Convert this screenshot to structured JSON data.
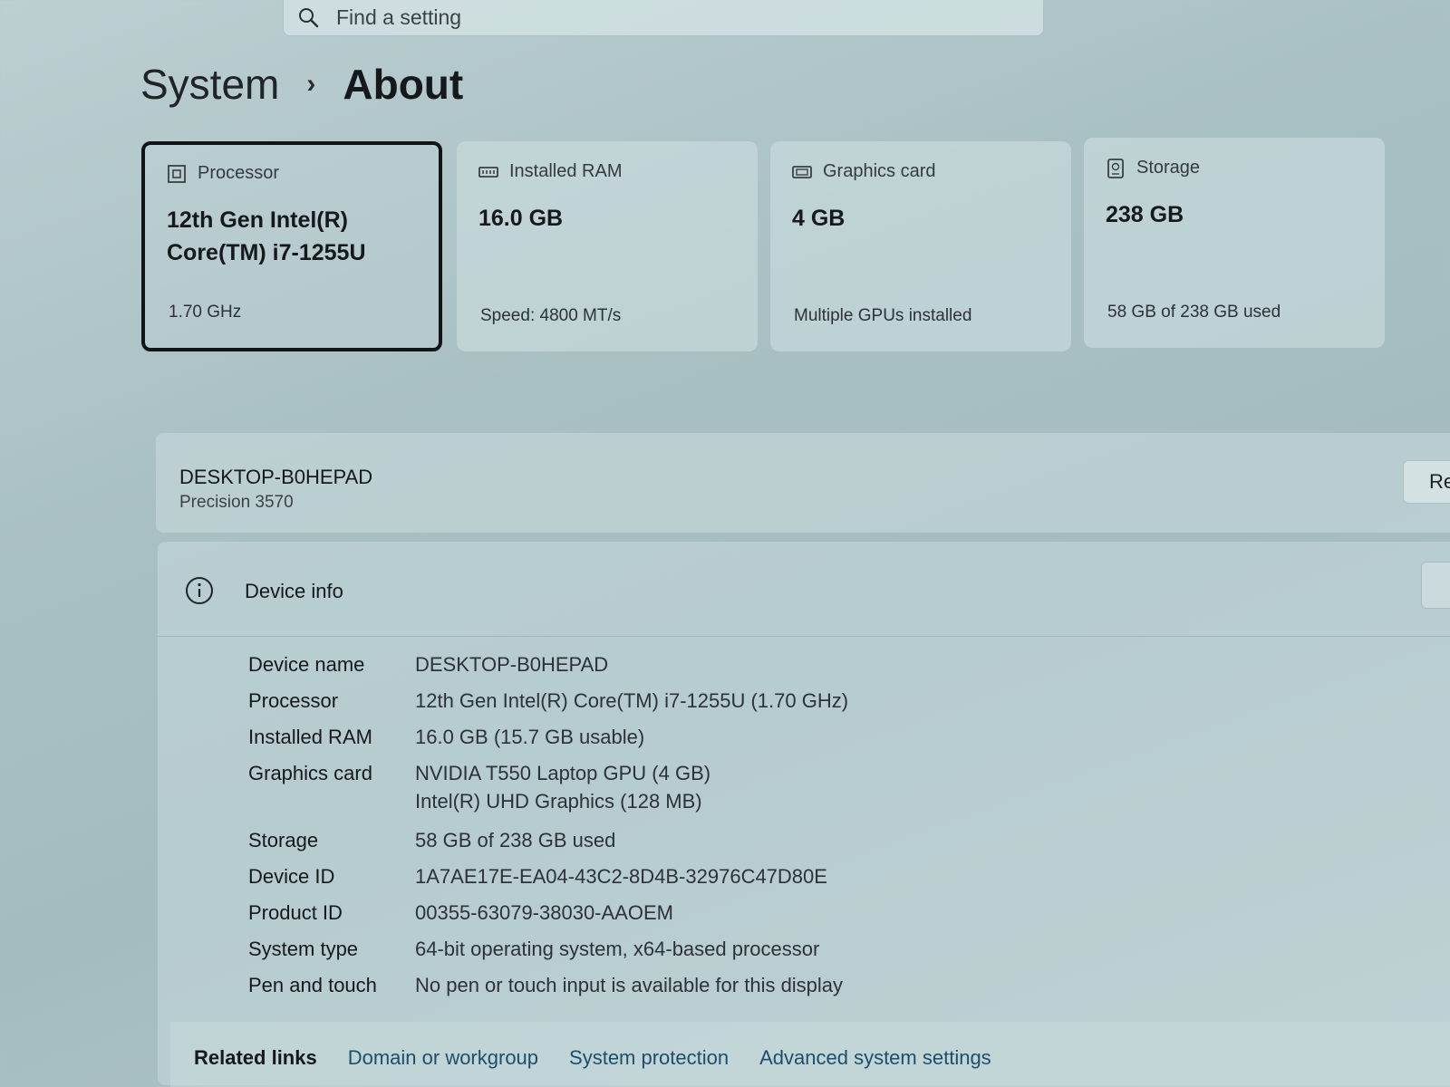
{
  "search": {
    "placeholder": "Find a setting"
  },
  "breadcrumb": {
    "parent": "System",
    "separator": "›",
    "current": "About"
  },
  "cards": [
    {
      "title": "Processor",
      "value_line1": "12th Gen Intel(R)",
      "value_line2": "Core(TM) i7-1255U",
      "sub": "1.70 GHz",
      "icon": "processor-icon"
    },
    {
      "title": "Installed RAM",
      "value_line1": "16.0 GB",
      "value_line2": "",
      "sub": "Speed: 4800 MT/s",
      "icon": "ram-icon"
    },
    {
      "title": "Graphics card",
      "value_line1": "4 GB",
      "value_line2": "",
      "sub": "Multiple GPUs installed",
      "icon": "graphics-card-icon"
    },
    {
      "title": "Storage",
      "value_line1": "238 GB",
      "value_line2": "",
      "sub": "58 GB of 238 GB used",
      "icon": "storage-icon"
    }
  ],
  "device": {
    "name": "DESKTOP-B0HEPAD",
    "model": "Precision 3570",
    "rename_label": "Re"
  },
  "device_info": {
    "title": "Device info",
    "rows": [
      {
        "key": "Device name",
        "value": "DESKTOP-B0HEPAD"
      },
      {
        "key": "Processor",
        "value": "12th Gen Intel(R) Core(TM) i7-1255U (1.70 GHz)"
      },
      {
        "key": "Installed RAM",
        "value": "16.0 GB (15.7 GB usable)"
      },
      {
        "key": "Graphics card",
        "value": "NVIDIA T550 Laptop GPU (4 GB)",
        "value2": "Intel(R) UHD Graphics (128 MB)"
      },
      {
        "key": "Storage",
        "value": "58 GB of 238 GB used"
      },
      {
        "key": "Device ID",
        "value": "1A7AE17E-EA04-43C2-8D4B-32976C47D80E"
      },
      {
        "key": "Product ID",
        "value": "00355-63079-38030-AAOEM"
      },
      {
        "key": "System type",
        "value": "64-bit operating system, x64-based processor"
      },
      {
        "key": "Pen and touch",
        "value": "No pen or touch input is available for this display"
      }
    ]
  },
  "related": {
    "label": "Related links",
    "links": [
      "Domain or workgroup",
      "System protection",
      "Advanced system settings"
    ]
  }
}
